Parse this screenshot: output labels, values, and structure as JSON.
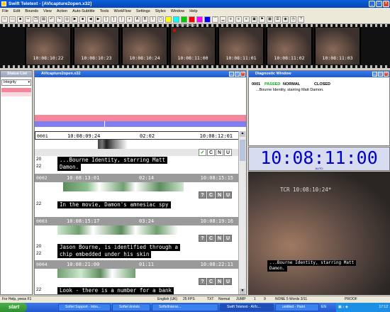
{
  "window": {
    "title": "Swift Teletext - [AVIcapture2open.x32]"
  },
  "menu": [
    "File",
    "Edit",
    "Bounds",
    "View",
    "Action",
    "Auto-Subtitle",
    "Tools",
    "WorkFlow",
    "Settings",
    "Styles",
    "Window",
    "Help"
  ],
  "filmstrip": {
    "label": "-SATNEM MARKET-",
    "timecodes": [
      "10:08:10:22",
      "10:08:10:23",
      "10:08:10:24",
      "10:08:11:00",
      "10:08:11:01",
      "10:08:11:02",
      "10:08:11:03"
    ]
  },
  "status_list": {
    "title": "Status List",
    "filter": "Integrity"
  },
  "editor": {
    "title": "AVIcapture2open.x32",
    "rows": [
      {
        "num": "0001",
        "in": "10:08:09:24",
        "dur": "02:02",
        "out": "10:08:12:01",
        "lines": [
          "20",
          "22"
        ],
        "subtitle": [
          "...Bourne Identity, starring Matt",
          "Damon."
        ],
        "check": "✓"
      },
      {
        "num": "0002",
        "in": "10:08:13:01",
        "dur": "02:14",
        "out": "10:08:15:15",
        "lines": [
          "22"
        ],
        "subtitle": [
          "In the movie, Damon's amnesiac spy"
        ],
        "check": "?"
      },
      {
        "num": "0003",
        "in": "10:08:15:17",
        "dur": "03:24",
        "out": "10:08:19:16",
        "lines": [
          "20",
          "22"
        ],
        "subtitle": [
          "Jason Bourne, is identified through a",
          "chip embedded under his skin"
        ],
        "check": "?"
      },
      {
        "num": "0004",
        "in": "10:08:21:00",
        "dur": "01:11",
        "out": "10:08:22:11",
        "lines": [
          "22"
        ],
        "subtitle": [
          "Look - there is a number for a bank"
        ],
        "check": "?"
      }
    ],
    "qc_letters": [
      "C",
      "N",
      "U"
    ]
  },
  "diagnostic": {
    "title": "Diagnostic Window",
    "num": "0001",
    "state": "PASSED",
    "mode": "NORMAL",
    "caption": "CLOSED",
    "text": "...Bourne Identity, starring Matt Damon."
  },
  "timecode_display": {
    "value": "10:08:11:00",
    "label": "AUTO"
  },
  "video": {
    "burn_in": "TCR 10:08:10:24*",
    "subtitle": [
      "...Bourne Identity, starring Matt",
      "Damon."
    ]
  },
  "statusbar": {
    "help": "For Help, press F1",
    "language": "English (UK)",
    "fps": "25 FPS",
    "format": "TXT",
    "mode": "Normal",
    "jump": "JUMP",
    "pos1": "1",
    "pos2": "9",
    "info": "NONE 5 Words 3/11",
    "proof": "PROOF"
  },
  "taskbar": {
    "start": "start",
    "tasks": [
      "Softel Support - Inbo...",
      "Softel drvtsts",
      "SoftelInterar...",
      "Swift Teletext - AVIc...",
      "untitled - Paint"
    ],
    "lang": "EN",
    "clock": "17:12"
  },
  "colors": {
    "passed": "#1aa01a",
    "pink_bar": "#f2869a",
    "blue_bar": "#7f7ff2",
    "timecode_blue": "#0000cc"
  }
}
